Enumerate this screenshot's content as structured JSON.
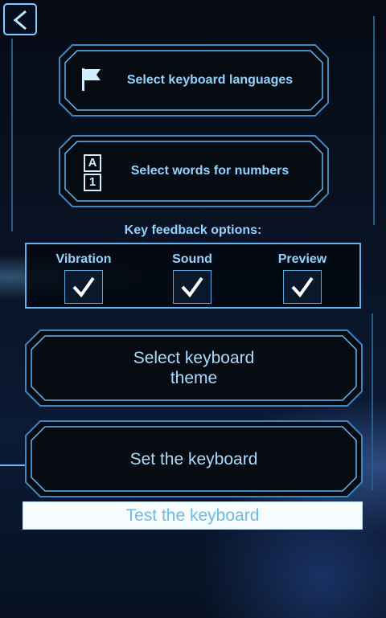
{
  "nav": {
    "back_icon": "chevron-left-icon"
  },
  "buttons": {
    "languages": {
      "label": "Select keyboard languages",
      "icon": "flag-icon"
    },
    "words": {
      "label": "Select words for numbers",
      "icon_top": "A",
      "icon_bottom": "1"
    },
    "theme": {
      "label_line1": "Select keyboard",
      "label_line2": "theme"
    },
    "set": {
      "label": "Set the keyboard"
    },
    "test": {
      "label": "Test the keyboard"
    }
  },
  "feedback": {
    "title": "Key feedback options:",
    "options": [
      {
        "label": "Vibration",
        "checked": true
      },
      {
        "label": "Sound",
        "checked": true
      },
      {
        "label": "Preview",
        "checked": true
      }
    ]
  },
  "colors": {
    "accent": "#8fd4ff",
    "border": "#5fb2ee",
    "background": "#050a14"
  }
}
